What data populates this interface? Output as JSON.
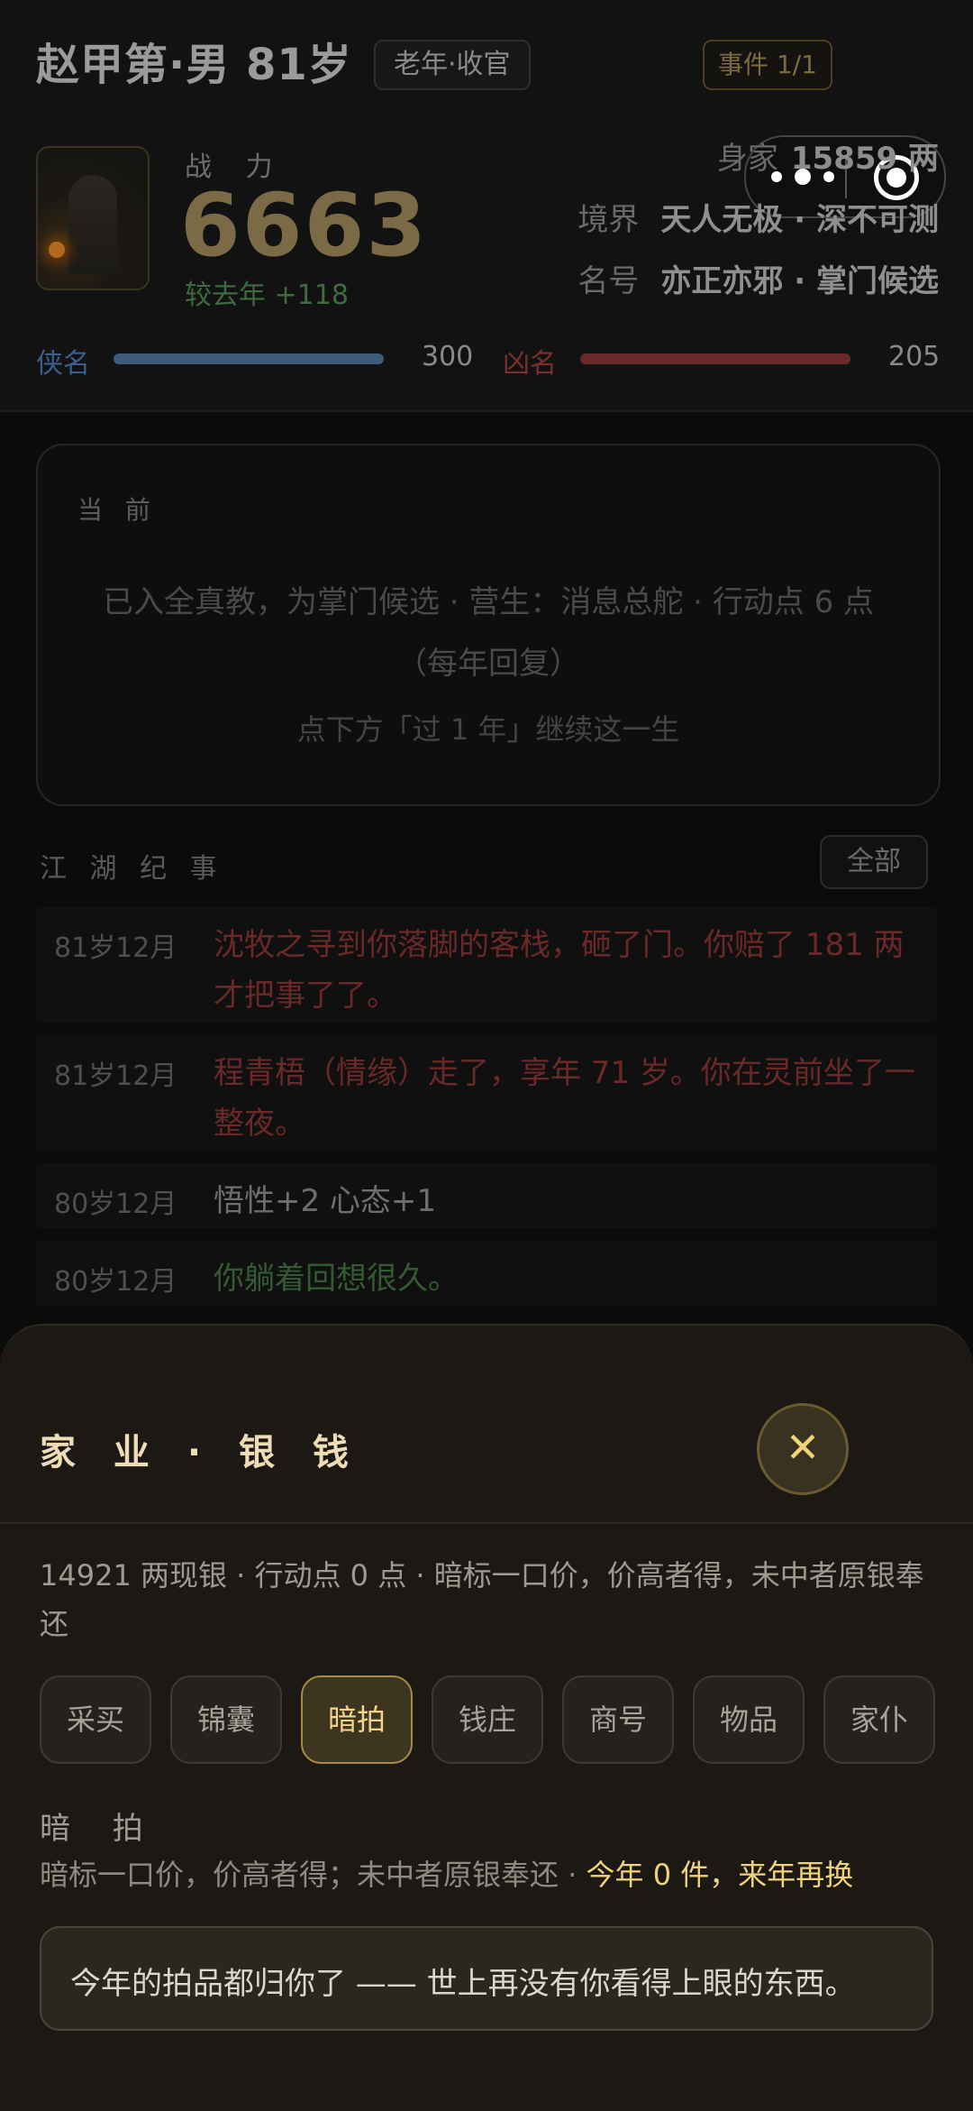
{
  "header": {
    "name": "赵甲第·男 81岁",
    "stage_tag": "老年·收官",
    "event_badge": "事件 1/1",
    "power_label": "战 力",
    "power_value": "6663",
    "power_delta": "较去年 +118",
    "wealth_label": "身家",
    "wealth_value": "15859 两",
    "realm_label": "境界",
    "realm_value": "天人无极 · 深不可测",
    "title_label": "名号",
    "title_value": "亦正亦邪 · 掌门候选",
    "avatar_icon": "character-portrait-icon",
    "menu_icon": "more-dots-icon",
    "capsule_icon": "target-icon"
  },
  "reputation": {
    "hero_label": "侠名",
    "hero_value": "300",
    "hero_fill": 1.0,
    "villain_label": "凶名",
    "villain_value": "205",
    "villain_fill": 1.0,
    "hero_color": "#3d5a7a",
    "villain_color": "#6b2a2a"
  },
  "current": {
    "caption": "当 前",
    "main": "已入全真教，为掌门候选 · 营生：消息总舵 · 行动点 6 点（每年回复）",
    "hint": "点下方「过 1 年」继续这一生"
  },
  "chronicle": {
    "title": "江 湖 纪 事",
    "all_button": "全部",
    "entries": [
      {
        "age": "81岁12月",
        "text": "沈牧之寻到你落脚的客栈，砸了门。你赔了 181 两才把事了了。"
      },
      {
        "age": "81岁12月",
        "text": "程青梧（情缘）走了，享年 71 岁。你在灵前坐了一整夜。"
      },
      {
        "age": "80岁12月",
        "text": "悟性+2 心态+1"
      },
      {
        "age": "80岁12月",
        "text": "你躺着回想很久。"
      }
    ]
  },
  "sheet": {
    "title": "家 业 · 银 钱",
    "close_icon": "close-icon",
    "info": "14921 两现银 · 行动点 0 点 · 暗标一口价，价高者得，未中者原银奉还",
    "tabs": [
      "采买",
      "锦囊",
      "暗拍",
      "钱庄",
      "商号",
      "物品",
      "家仆"
    ],
    "active_tab": "暗拍",
    "section_title": "暗 拍",
    "section_desc": "暗标一口价，价高者得；未中者原银奉还 · ",
    "section_highlight": "今年 0 件，来年再换",
    "notice": "今年的拍品都归你了 —— 世上再没有你看得上眼的东西。"
  }
}
